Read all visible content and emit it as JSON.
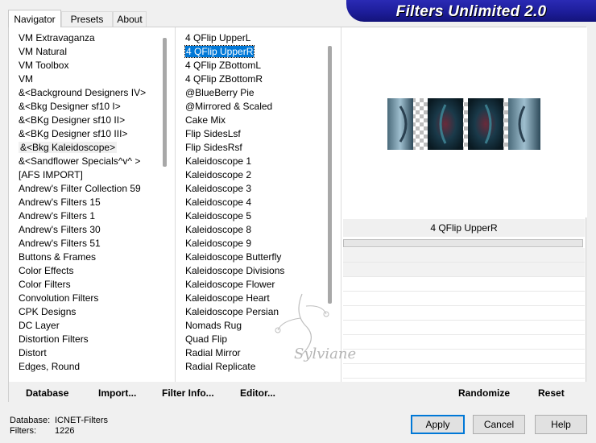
{
  "title": "Filters Unlimited 2.0",
  "tabs": [
    {
      "label": "Navigator",
      "active": true
    },
    {
      "label": "Presets",
      "active": false
    },
    {
      "label": "About",
      "active": false
    }
  ],
  "categories": [
    "VM Extravaganza",
    "VM Natural",
    "VM Toolbox",
    "VM",
    "&<Background Designers IV>",
    "&<Bkg Designer sf10 I>",
    "&<BKg Designer sf10 II>",
    "&<BKg Designer sf10 III>",
    "&<Bkg Kaleidoscope>",
    "&<Sandflower Specials^v^ >",
    "[AFS IMPORT]",
    "Andrew's Filter Collection 59",
    "Andrew's Filters 15",
    "Andrew's Filters 1",
    "Andrew's Filters 30",
    "Andrew's Filters 51",
    "Buttons & Frames",
    "Color Effects",
    "Color Filters",
    "Convolution Filters",
    "CPK Designs",
    "DC Layer",
    "Distortion Filters",
    "Distort",
    "Edges, Round"
  ],
  "selected_category": "&<Bkg Kaleidoscope>",
  "filters": [
    "4 QFlip UpperL",
    "4 QFlip UpperR",
    "4 QFlip ZBottomL",
    "4 QFlip ZBottomR",
    "@BlueBerry Pie",
    "@Mirrored & Scaled",
    "Cake Mix",
    "Flip SidesLsf",
    "Flip SidesRsf",
    "Kaleidoscope 1",
    "Kaleidoscope 2",
    "Kaleidoscope 3",
    "Kaleidoscope 4",
    "Kaleidoscope 5",
    "Kaleidoscope 8",
    "Kaleidoscope 9",
    "Kaleidoscope Butterfly",
    "Kaleidoscope Divisions",
    "Kaleidoscope Flower",
    "Kaleidoscope Heart",
    "Kaleidoscope Persian",
    "Nomads Rug",
    "Quad Flip",
    "Radial Mirror",
    "Radial Replicate"
  ],
  "selected_filter": "4 QFlip UpperR",
  "preview": {
    "filter_name": "4 QFlip UpperR"
  },
  "toolbar": {
    "database": "Database",
    "import": "Import...",
    "filter_info": "Filter Info...",
    "editor": "Editor...",
    "randomize": "Randomize",
    "reset": "Reset"
  },
  "status": {
    "database_label": "Database:",
    "database_value": "ICNET-Filters",
    "filters_label": "Filters:",
    "filters_value": "1226"
  },
  "buttons": {
    "apply": "Apply",
    "cancel": "Cancel",
    "help": "Help"
  },
  "watermark": "Sylviane",
  "colors": {
    "accent": "#0078d7",
    "banner": "#1d1d9a"
  }
}
